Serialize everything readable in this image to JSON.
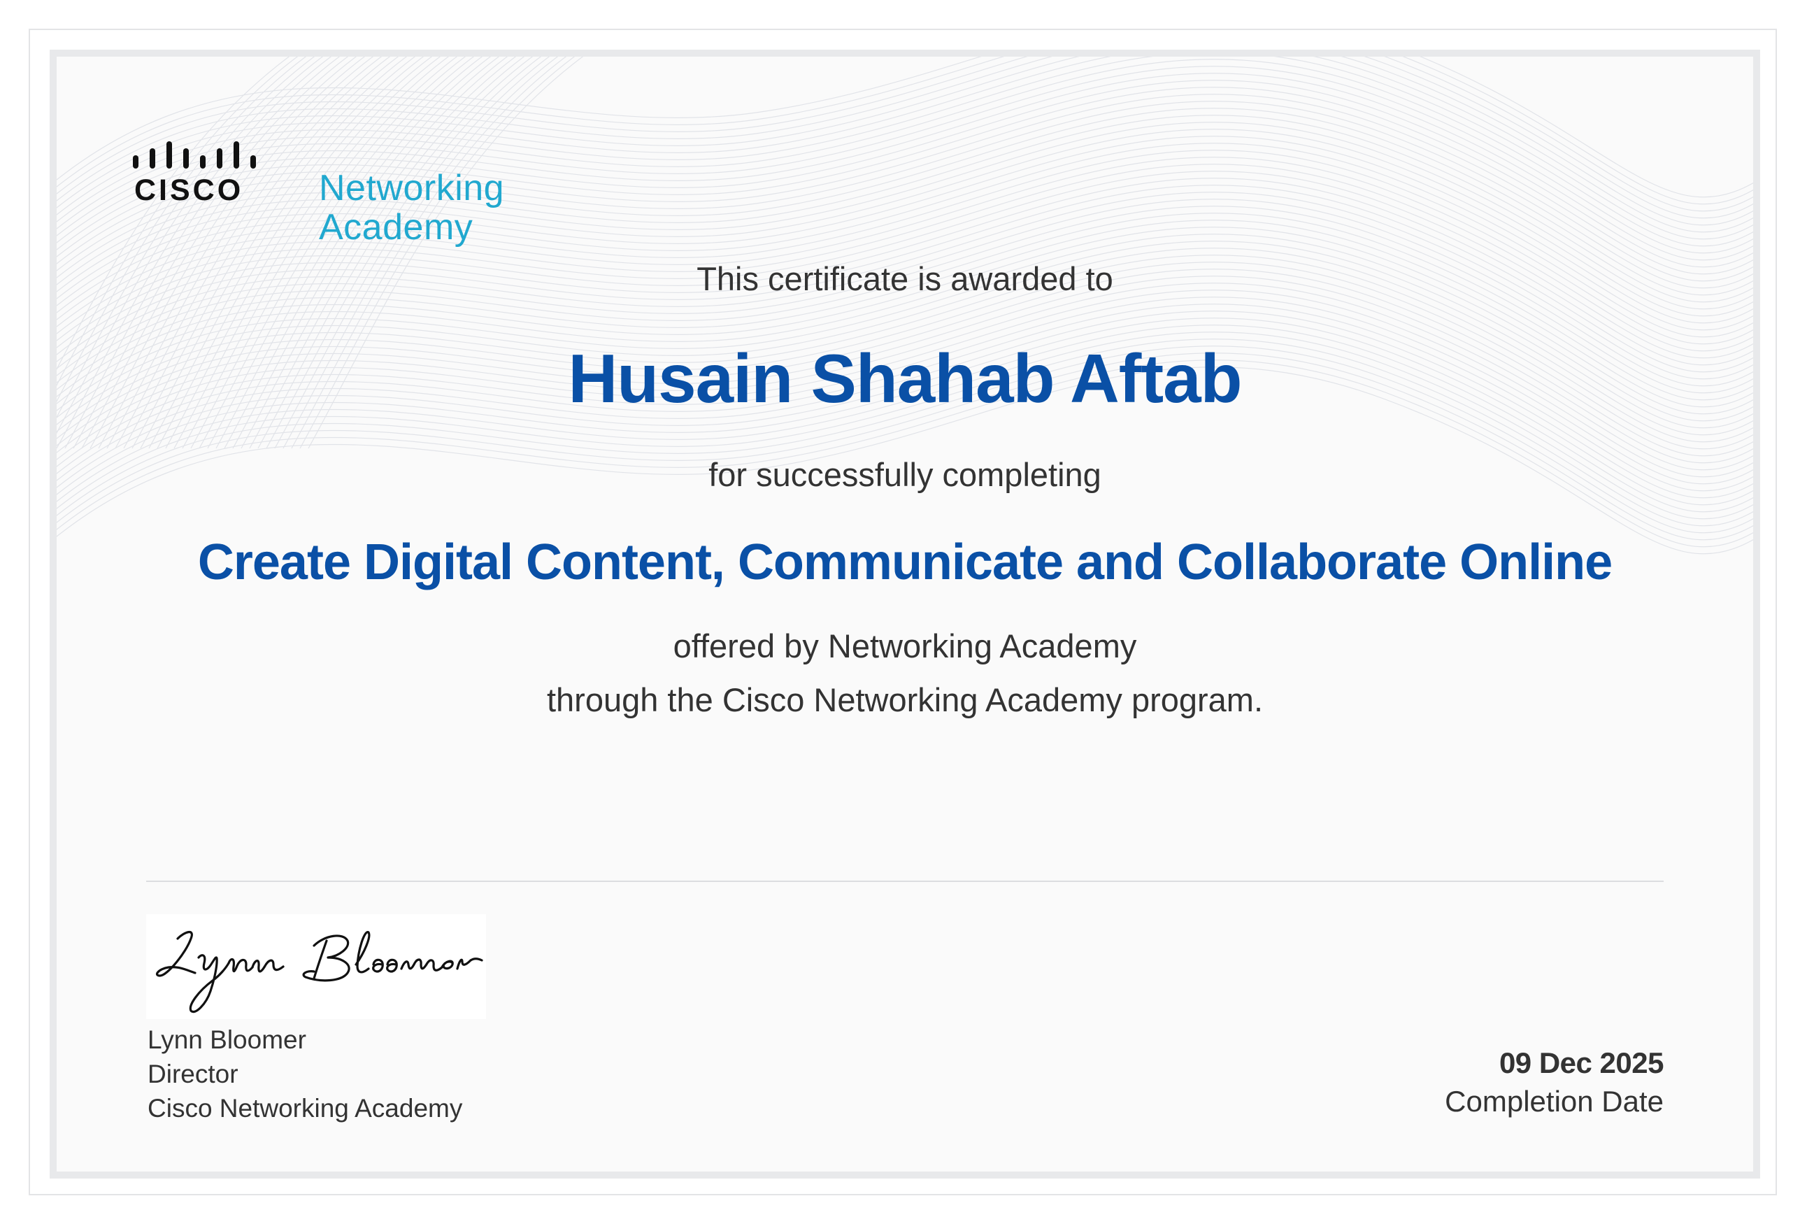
{
  "logo": {
    "brand": "CISCO",
    "line1": "Networking",
    "line2": "Academy",
    "accent_color": "#21a8cf"
  },
  "certificate": {
    "intro": "This certificate is awarded to",
    "recipient": "Husain Shahab Aftab",
    "completing": "for successfully completing",
    "course": "Create Digital Content, Communicate and Collaborate Online",
    "offered_by": "offered by Networking Academy",
    "program": "through the Cisco Networking Academy program.",
    "highlight_color": "#0a50a6"
  },
  "signatory": {
    "signature": "Lynn Bloomer",
    "name": "Lynn Bloomer",
    "title": "Director",
    "organization": "Cisco Networking Academy"
  },
  "completion": {
    "date": "09 Dec 2025",
    "label": "Completion Date"
  }
}
